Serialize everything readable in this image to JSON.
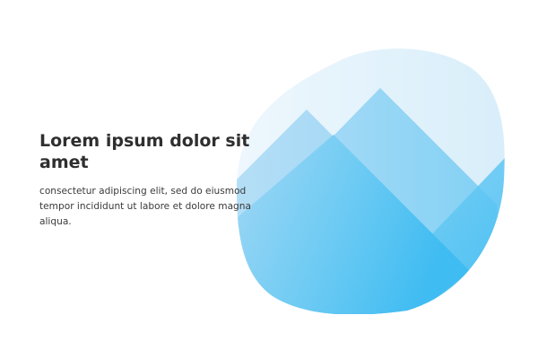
{
  "hero": {
    "headline": "Lorem ipsum dolor sit amet",
    "body": "consectetur adipiscing elit, sed do eiusmod tempor incididunt ut labore et dolore magna aliqua."
  },
  "illustration": {
    "icon": "mountains-illustration",
    "colors": {
      "sky": "#dcf0fb",
      "sky_light": "#f1f8fd",
      "mountain_light": "#a9dbf6",
      "mountain_mid": "#6fccf4",
      "mountain_deep": "#3dbcf2"
    }
  }
}
